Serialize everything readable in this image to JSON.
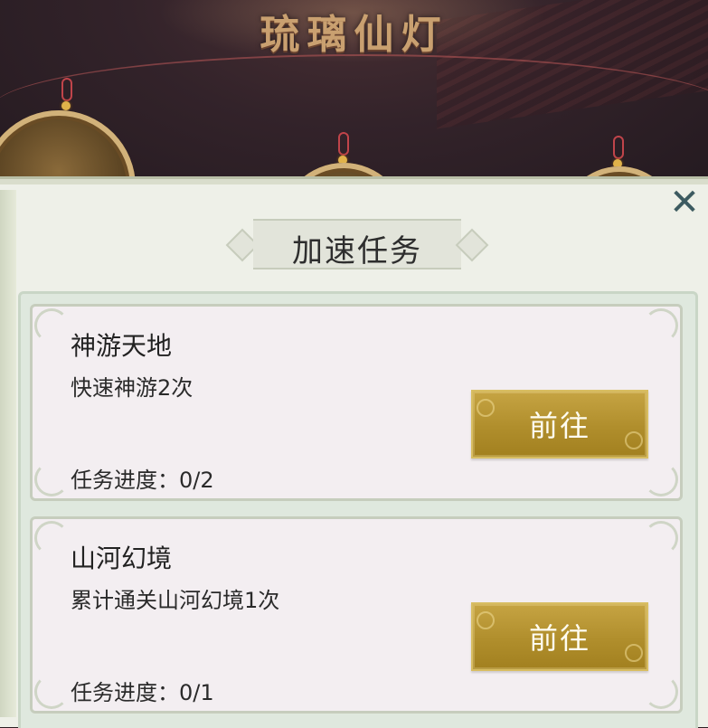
{
  "scene": {
    "title": "琉璃仙灯"
  },
  "panel": {
    "title": "加速任务",
    "close_icon": "close-x-icon"
  },
  "tasks": [
    {
      "name": "神游天地",
      "description": "快速神游2次",
      "progress_label": "任务进度：",
      "progress_value": "0/2",
      "button_label": "前往"
    },
    {
      "name": "山河幻境",
      "description": "累计通关山河幻境1次",
      "progress_label": "任务进度：",
      "progress_value": "0/1",
      "button_label": "前往"
    }
  ],
  "colors": {
    "button_gold": "#b08e2c",
    "panel_bg": "#eef0e8",
    "card_bg": "#f3eef1",
    "close_icon": "#3c5a60"
  }
}
